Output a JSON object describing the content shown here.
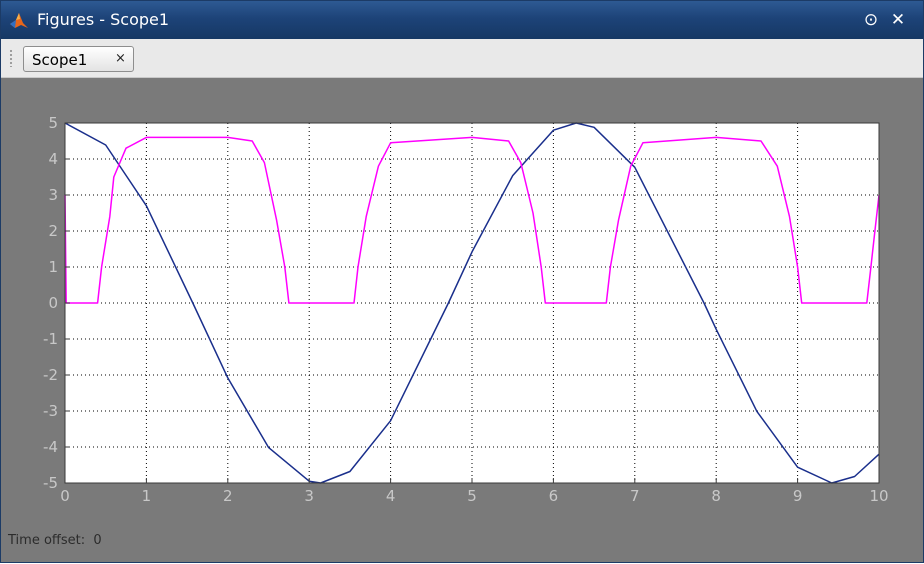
{
  "window": {
    "title": "Figures - Scope1"
  },
  "controls": {
    "undock_glyph": "⊙",
    "close_glyph": "✕"
  },
  "tabs": [
    {
      "label": "Scope1",
      "close_glyph": "×"
    }
  ],
  "footer": {
    "time_offset_label": "Time offset:",
    "time_offset_value": "0"
  },
  "colors": {
    "title_bar": "#1d4378",
    "background": "#7a7a7a",
    "plot_bg": "#ffffff",
    "sine_series": "#1a2f8c",
    "rectified_series": "#ff00ff",
    "grid": "#000000",
    "tick_label": "#c8c8c8"
  },
  "icons": {
    "app": "matlab-logo-icon",
    "undock": "undock-icon",
    "close": "close-icon",
    "tab_close": "close-icon"
  },
  "chart_data": {
    "type": "line",
    "title": "",
    "xlabel": "",
    "ylabel": "",
    "xlim": [
      0,
      10
    ],
    "ylim": [
      -5,
      5
    ],
    "x_ticks": [
      0,
      1,
      2,
      3,
      4,
      5,
      6,
      7,
      8,
      9,
      10
    ],
    "y_ticks": [
      -5,
      -4,
      -3,
      -2,
      -1,
      0,
      1,
      2,
      3,
      4,
      5
    ],
    "grid": true,
    "legend": "none",
    "series": [
      {
        "color": "#1a2f8c",
        "x": [
          0,
          0.5,
          1,
          1.57,
          2,
          2.5,
          3,
          3.14,
          3.5,
          4,
          4.71,
          5,
          5.5,
          6,
          6.28,
          6.5,
          7,
          7.85,
          8,
          8.5,
          9,
          9.42,
          9.7,
          10
        ],
        "y": [
          5,
          4.39,
          2.7,
          0,
          -2.08,
          -4.01,
          -4.95,
          -5,
          -4.68,
          -3.27,
          0,
          1.42,
          3.54,
          4.8,
          5,
          4.88,
          3.77,
          0,
          -0.73,
          -3.01,
          -4.56,
          -5,
          -4.82,
          -4.2
        ]
      },
      {
        "color": "#ff00ff",
        "x": [
          0,
          0.015,
          0.4,
          0.45,
          0.55,
          0.6,
          0.75,
          1,
          2,
          2.3,
          2.45,
          2.6,
          2.7,
          2.75,
          3.55,
          3.6,
          3.7,
          3.85,
          4,
          5,
          5.45,
          5.6,
          5.75,
          5.85,
          5.9,
          6.65,
          6.7,
          6.8,
          6.95,
          7.1,
          8,
          8.55,
          8.75,
          8.9,
          9,
          9.05,
          9.85,
          9.9,
          9.95,
          10
        ],
        "y": [
          3,
          0,
          0,
          1,
          2.4,
          3.5,
          4.3,
          4.6,
          4.6,
          4.5,
          3.9,
          2.3,
          1,
          0,
          0,
          1,
          2.4,
          3.8,
          4.45,
          4.6,
          4.5,
          3.9,
          2.5,
          1,
          0,
          0,
          1,
          2.3,
          3.8,
          4.45,
          4.6,
          4.5,
          3.8,
          2.4,
          1,
          0,
          0,
          1,
          2,
          3
        ]
      }
    ]
  }
}
